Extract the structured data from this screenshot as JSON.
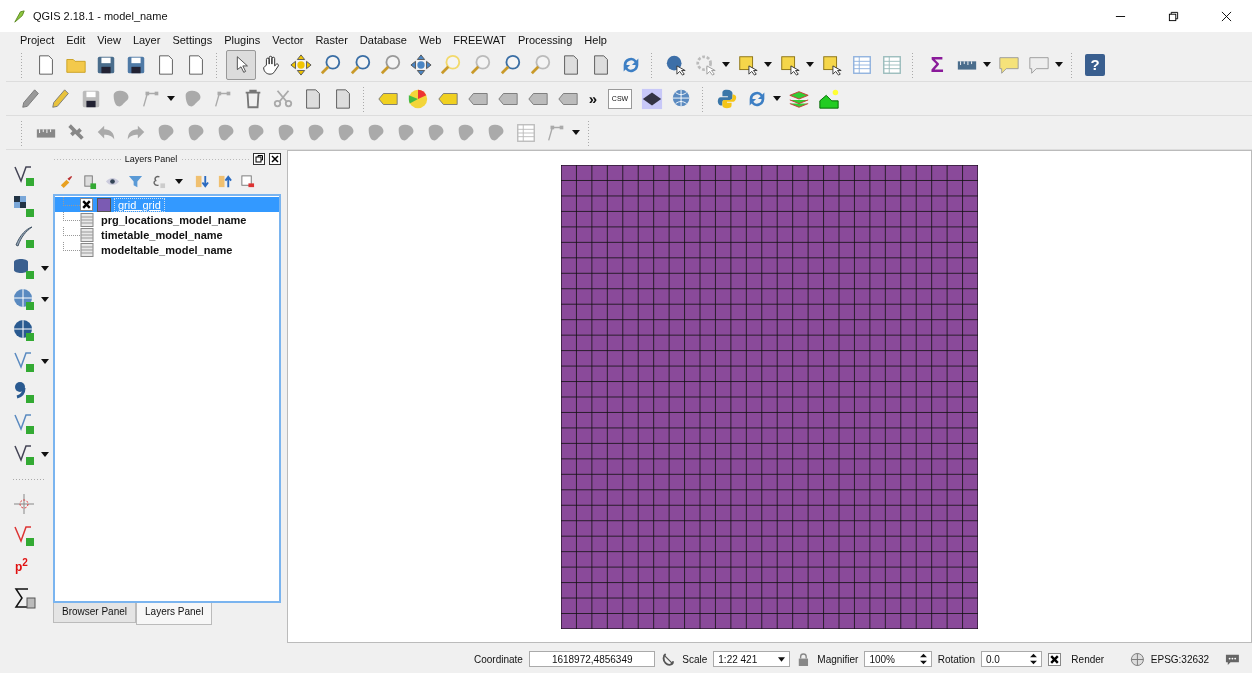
{
  "window": {
    "title": "QGIS 2.18.1 - model_name"
  },
  "menu": [
    "Project",
    "Edit",
    "View",
    "Layer",
    "Settings",
    "Plugins",
    "Vector",
    "Raster",
    "Database",
    "Web",
    "FREEWAT",
    "Processing",
    "Help"
  ],
  "toolbar_glyphs": {
    "sigma": "Σ",
    "help": "?",
    "more": "»",
    "csw": "CSW"
  },
  "left_toolbar_glyphs": {
    "measure": "p$^{2}$"
  },
  "layers_panel": {
    "title": "Layers Panel",
    "layers": [
      {
        "name": "grid_grid",
        "kind": "vector",
        "checked": true,
        "selected": true
      },
      {
        "name": "prg_locations_model_name",
        "kind": "table",
        "selected": false
      },
      {
        "name": "timetable_model_name",
        "kind": "table",
        "selected": false
      },
      {
        "name": "modeltable_model_name",
        "kind": "table",
        "selected": false
      }
    ]
  },
  "panel_tabs": [
    {
      "label": "Browser Panel",
      "selected": false
    },
    {
      "label": "Layers Panel",
      "selected": true
    }
  ],
  "status_bar": {
    "coordinate_label": "Coordinate",
    "coordinate": "1618972,4856349",
    "scale_label": "Scale",
    "scale": "1:22 421",
    "magnifier_label": "Magnifier",
    "magnifier": "100%",
    "rotation_label": "Rotation",
    "rotation": "0.0",
    "render_label": "Render",
    "render_checked": true,
    "crs": "EPSG:32632"
  }
}
